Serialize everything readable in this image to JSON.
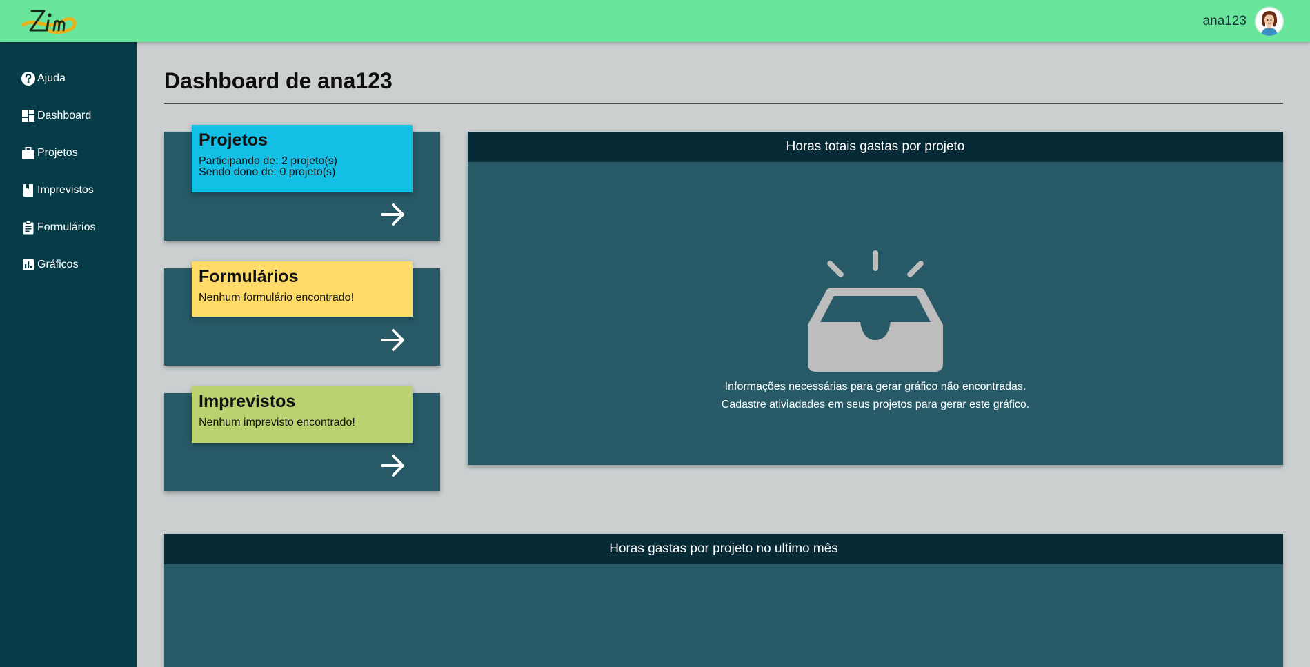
{
  "header": {
    "logo_icon": "zim-logo",
    "user_name": "ana123",
    "avatar_icon": "user-avatar-icon",
    "background": "#69e69c"
  },
  "sidebar": {
    "background": "#063c48",
    "items": [
      {
        "label": "Ajuda",
        "icon": "help-icon"
      },
      {
        "label": "Dashboard",
        "icon": "dashboard-icon"
      },
      {
        "label": "Projetos",
        "icon": "briefcase-icon"
      },
      {
        "label": "Imprevistos",
        "icon": "book-icon"
      },
      {
        "label": "Formulários",
        "icon": "clipboard-icon"
      },
      {
        "label": "Gráficos",
        "icon": "chart-icon"
      }
    ]
  },
  "main": {
    "title": "Dashboard de ana123",
    "cards": [
      {
        "title": "Projetos",
        "lines": [
          "Participando de: 2 projeto(s)",
          "Sendo dono de: 0 projeto(s)"
        ],
        "color": "#14bfe6",
        "arrow_icon": "arrow-right-icon"
      },
      {
        "title": "Formulários",
        "lines": [
          "Nenhum formulário encontrado!"
        ],
        "color": "#ffdc6a",
        "arrow_icon": "arrow-right-icon"
      },
      {
        "title": "Imprevistos",
        "lines": [
          "Nenhum imprevisto encontrado!"
        ],
        "color": "#bad26f",
        "arrow_icon": "arrow-right-icon"
      }
    ],
    "chart_panel": {
      "title": "Horas totais gastas por projeto",
      "empty_icon": "empty-inbox-icon",
      "empty_lines": [
        "Informações necessárias para gerar gráfico não encontradas.",
        "Cadastre ativiadades em seus projetos para gerar este gráfico."
      ]
    },
    "bottom_panel": {
      "title": "Horas gastas por projeto no ultimo mês"
    }
  }
}
